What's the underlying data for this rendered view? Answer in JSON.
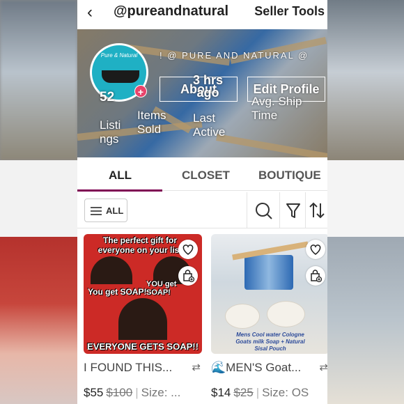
{
  "header": {
    "back_glyph": "‹",
    "handle": "@pureandnatural",
    "seller_tools": "Seller Tools"
  },
  "profile": {
    "shop_name": "! @ PURE AND NATURAL @",
    "avatar_text": "Pure & Natural",
    "listings_count": "52",
    "listings_label": "Listi\nngs",
    "items_sold_label": "Items\nSold",
    "about_label": "About",
    "last_active_value": "3 hrs\nago",
    "last_active_label": "Last\nActive",
    "edit_profile_label": "Edit Profile",
    "avg_ship_label": "Avg. Ship\nTime"
  },
  "tabs": [
    {
      "label": "ALL",
      "active": true
    },
    {
      "label": "CLOSET",
      "active": false
    },
    {
      "label": "BOUTIQUE",
      "active": false
    }
  ],
  "filter": {
    "all_label": "ALL",
    "tools": [
      "search-icon",
      "filter-icon",
      "sort-icon"
    ]
  },
  "listings": [
    {
      "title": "I FOUND THIS...",
      "price": "$55",
      "original_price": "$100",
      "size": "Size: ...",
      "image_text": {
        "top": "The perfect gift for everyone on your list",
        "mid_left": "You get SOAP!",
        "mid_right": "YOU get SOAP!",
        "bottom": "EVERYONE GETS SOAP!!"
      }
    },
    {
      "title": "🌊MEN'S Goat...",
      "price": "$14",
      "original_price": "$25",
      "size": "Size: OS",
      "image_text": {
        "caption": "Mens Cool water Cologne Goats milk Soap + Natural Sisal Pouch"
      }
    }
  ],
  "colors": {
    "accent": "#7f0353",
    "badge": "#e8446b",
    "avatar_bg": "#1fb0c4"
  }
}
